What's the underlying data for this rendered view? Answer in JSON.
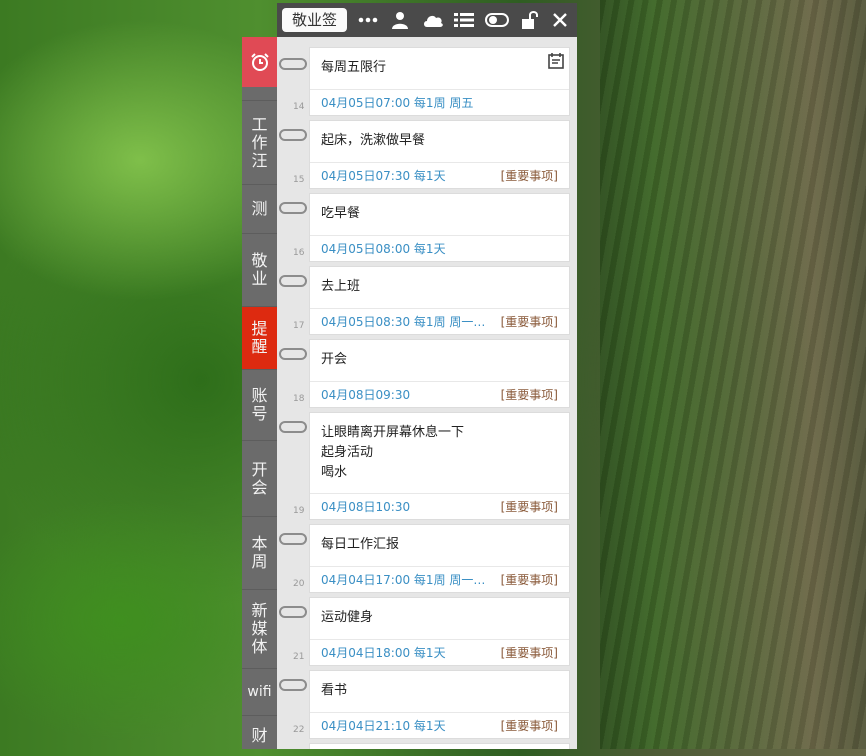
{
  "app": {
    "title": "敬业签"
  },
  "toolbar_icons": [
    "more-icon",
    "user-icon",
    "cloud-icon",
    "list-icon",
    "toggle-icon",
    "unlock-icon",
    "close-icon"
  ],
  "sidebar": {
    "alarm_icon": "alarm-clock-icon",
    "tabs": [
      {
        "label": "工作汪"
      },
      {
        "label": "测"
      },
      {
        "label": "敬业"
      },
      {
        "label": "提醒",
        "active": true
      },
      {
        "label": "账号"
      },
      {
        "label": "开会"
      },
      {
        "label": "本周"
      },
      {
        "label": "新媒体"
      },
      {
        "label": "wifi"
      },
      {
        "label": "财"
      }
    ]
  },
  "items": [
    {
      "num": "14",
      "title": "每周五限行",
      "when": "04月05日07:00 每1周 周五",
      "tag": ""
    },
    {
      "num": "15",
      "title": "起床，洗漱做早餐",
      "when": "04月05日07:30 每1天",
      "tag": "[重要事项]"
    },
    {
      "num": "16",
      "title": "吃早餐",
      "when": "04月05日08:00 每1天",
      "tag": ""
    },
    {
      "num": "17",
      "title": "去上班",
      "when": "04月05日08:30 每1周 周一…",
      "tag": "[重要事项]"
    },
    {
      "num": "18",
      "title": "开会",
      "when": "04月08日09:30",
      "tag": "[重要事项]"
    },
    {
      "num": "19",
      "title": "让眼睛离开屏幕休息一下\n起身活动\n喝水",
      "when": "04月08日10:30",
      "tag": "[重要事项]"
    },
    {
      "num": "20",
      "title": "每日工作汇报",
      "when": "04月04日17:00 每1周 周一…",
      "tag": "[重要事项]"
    },
    {
      "num": "21",
      "title": "运动健身",
      "when": "04月04日18:00 每1天",
      "tag": "[重要事项]"
    },
    {
      "num": "22",
      "title": "看书",
      "when": "04月04日21:10 每1天",
      "tag": "[重要事项]"
    }
  ]
}
